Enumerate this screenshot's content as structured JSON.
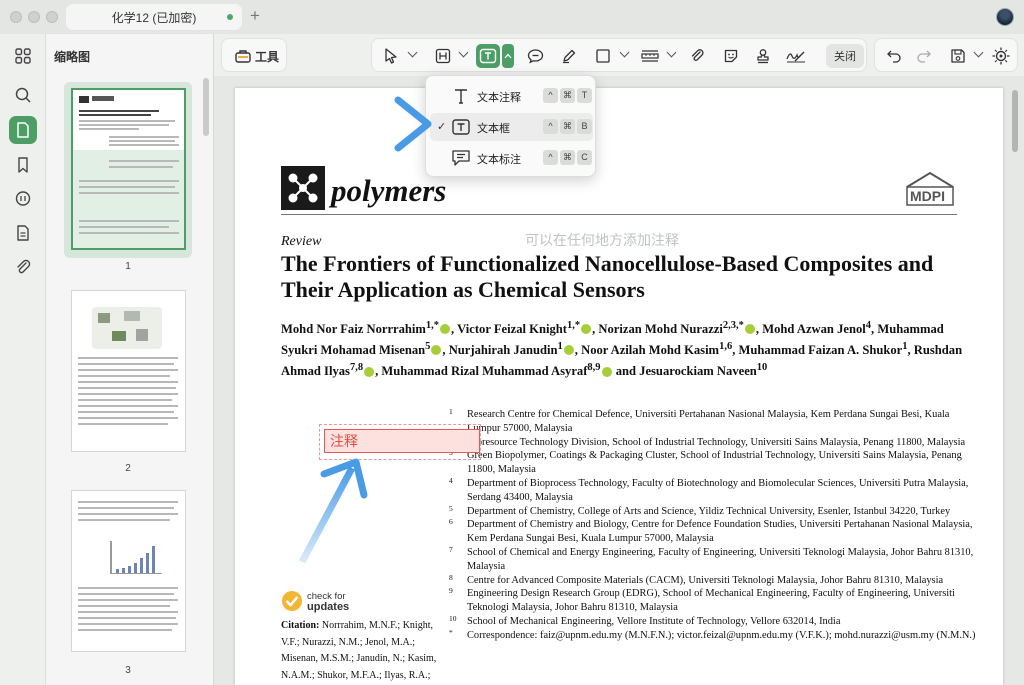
{
  "window": {
    "tab_title": "化学12 (已加密)",
    "new_tab": "+"
  },
  "sidebar": {
    "panel_title": "缩略图"
  },
  "thumbnails": [
    {
      "page": "1"
    },
    {
      "page": "2"
    },
    {
      "page": "3"
    }
  ],
  "toolbar": {
    "tools_label": "工具",
    "close_label": "关闭"
  },
  "text_menu": {
    "items": [
      {
        "label": "文本注释",
        "keys": [
          "^",
          "⌘",
          "T"
        ],
        "selected": false
      },
      {
        "label": "文本框",
        "keys": [
          "^",
          "⌘",
          "B"
        ],
        "selected": true
      },
      {
        "label": "文本标注",
        "keys": [
          "^",
          "⌘",
          "C"
        ],
        "selected": false
      }
    ],
    "check": "✓"
  },
  "document": {
    "journal": "polymers",
    "publisher": "MDPI",
    "hint": "可以在任何地方添加注释",
    "article_type": "Review",
    "title": "The Frontiers of Functionalized Nanocellulose-Based Composites and Their Application as Chemical Sensors",
    "authors": {
      "a1": "Mohd Nor Faiz Norrrahim",
      "s1": "1,*",
      "a2": ", Victor Feizal Knight",
      "s2": "1,*",
      "a3": ", Norizan Mohd Nurazzi",
      "s3": "2,3,*",
      "a4": ", Mohd Azwan Jenol",
      "s4": "4",
      "a5": ", Muhammad Syukri Mohamad Misenan",
      "s5": "5",
      "a6": ", Nurjahirah Janudin",
      "s6": "1",
      "a7": ", Noor Azilah Mohd Kasim",
      "s7": "1,6",
      "a8": ", Muhammad Faizan A. Shukor",
      "s8": "1",
      "a9": ", Rushdan Ahmad Ilyas",
      "s9": "7,8",
      "a10": ", Muhammad Rizal Muhammad Asyraf",
      "s10": "8,9",
      "a11": " and Jesuarockiam Naveen",
      "s11": "10"
    },
    "affiliations": [
      {
        "n": "1",
        "text": "Research Centre for Chemical Defence, Universiti Pertahanan Nasional Malaysia, Kem Perdana Sungai Besi, Kuala Lumpur 57000, Malaysia"
      },
      {
        "n": "2",
        "text": "Bioresource Technology Division, School of Industrial Technology, Universiti Sains Malaysia, Penang 11800, Malaysia"
      },
      {
        "n": "3",
        "text": "Green Biopolymer, Coatings & Packaging Cluster, School of Industrial Technology, Universiti Sains Malaysia, Penang 11800, Malaysia"
      },
      {
        "n": "4",
        "text": "Department of Bioprocess Technology, Faculty of Biotechnology and Biomolecular Sciences, Universiti Putra Malaysia, Serdang 43400, Malaysia"
      },
      {
        "n": "5",
        "text": "Department of Chemistry, College of Arts and Science, Yildiz Technical University, Esenler, Istanbul 34220, Turkey"
      },
      {
        "n": "6",
        "text": "Department of Chemistry and Biology, Centre for Defence Foundation Studies, Universiti Pertahanan Nasional Malaysia, Kem Perdana Sungai Besi, Kuala Lumpur 57000, Malaysia"
      },
      {
        "n": "7",
        "text": "School of Chemical and Energy Engineering, Faculty of Engineering, Universiti Teknologi Malaysia, Johor Bahru 81310, Malaysia"
      },
      {
        "n": "8",
        "text": "Centre for Advanced Composite Materials (CACM), Universiti Teknologi Malaysia, Johor Bahru 81310, Malaysia"
      },
      {
        "n": "9",
        "text": "Engineering Design Research Group (EDRG), School of Mechanical Engineering, Faculty of Engineering, Universiti Teknologi Malaysia, Johor Bahru 81310, Malaysia"
      },
      {
        "n": "10",
        "text": "School of Mechanical Engineering, Vellore Institute of Technology, Vellore 632014, India"
      },
      {
        "n": "*",
        "text": "Correspondence: faiz@upnm.edu.my (M.N.F.N.); victor.feizal@upnm.edu.my (V.F.K.); mohd.nurazzi@usm.my (N.M.N.)"
      }
    ],
    "annotation_text": "注释",
    "check_updates_line1": "check for",
    "check_updates_line2": "updates",
    "citation_label": "Citation:",
    "citation_text": " Norrrahim, M.N.F.; Knight, V.F.; Nurazzi, N.M.; Jenol, M.A.; Misenan, M.S.M.; Janudin, N.; Kasim, N.A.M.; Shukor, M.F.A.; Ilyas, R.A.; Asyraf, M.R.M.; et al. The Frontiers of"
  },
  "colors": {
    "accent": "#4c9e66",
    "arrow": "#4a9be6",
    "annotation_red": "#e04f45"
  }
}
